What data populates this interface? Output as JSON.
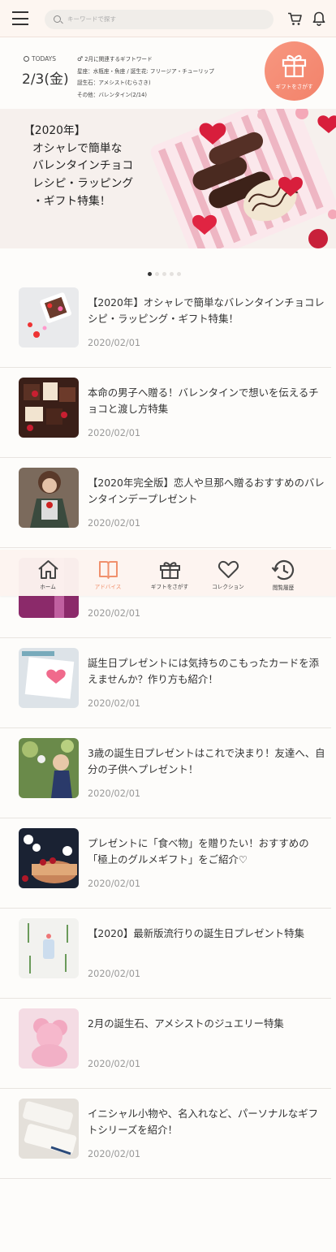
{
  "header": {
    "search_placeholder": "キーワードで探す"
  },
  "today": {
    "label": "TODAYS",
    "date": "2/3(金)",
    "gift_word_title": "2月に関連するギフトワード",
    "line1": "星座：水瓶座・魚座 / 誕生花: フリージア・チューリップ",
    "line2": "誕生石：アメシスト(むらさき)",
    "line3": "その他：バレンタイン(2/14)",
    "gift_button": "ギフトをさがす"
  },
  "hero": {
    "lines": [
      "【2020年】",
      "オシャレで簡単な",
      "バレンタインチョコ",
      "レシピ・ラッピング",
      "・ギフト特集！"
    ]
  },
  "articles": [
    {
      "title": "【2020年】オシャレで簡単なバレンタインチョコレシピ・ラッピング・ギフト特集！",
      "date": "2020/02/01"
    },
    {
      "title": "本命の男子へ贈る！バレンタインで想いを伝えるチョコと渡し方特集",
      "date": "2020/02/01"
    },
    {
      "title": "【2020年完全版】恋人や旦那へ贈るおすすめのバレンタインデープレゼント",
      "date": "2020/02/01"
    },
    {
      "title": "",
      "date": "2020/02/01"
    },
    {
      "title": "誕生日プレゼントには気持ちのこもったカードを添えませんか？作り方も紹介！",
      "date": "2020/02/01"
    },
    {
      "title": "3歳の誕生日プレゼントはこれで決まり！友達へ、自分の子供へプレゼント！",
      "date": "2020/02/01"
    },
    {
      "title": "プレゼントに「食べ物」を贈りたい！おすすめの「極上のグルメギフト」をご紹介♡",
      "date": "2020/02/01"
    },
    {
      "title": "【2020】最新版流行りの誕生日プレゼント特集",
      "date": "2020/02/01"
    },
    {
      "title": "2月の誕生石、アメシストのジュエリー特集",
      "date": "2020/02/01"
    },
    {
      "title": "イニシャル小物や、名入れなど、パーソナルなギフトシリーズを紹介！",
      "date": "2020/02/01"
    }
  ],
  "nav": {
    "home": "ホーム",
    "advice": "アドバイス",
    "gift_search": "ギフトをさがす",
    "collection": "コレクション",
    "history": "閲覧履歴"
  },
  "colors": {
    "accent": "#f2826a",
    "header_bg": "#fdf6f1"
  }
}
